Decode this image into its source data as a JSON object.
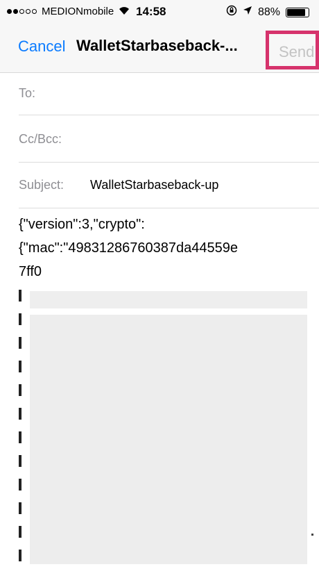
{
  "status_bar": {
    "signal_filled": 2,
    "signal_empty": 3,
    "carrier": "MEDIONmobile",
    "time": "14:58",
    "battery": "88%",
    "icons": [
      "wifi-icon",
      "lock-rotation-icon",
      "location-arrow-icon",
      "battery-icon"
    ]
  },
  "nav": {
    "cancel_label": "Cancel",
    "title": "WalletStarbaseback-...",
    "send_label": "Send",
    "highlight_color": "#d6336c",
    "accent_color": "#0a7bff"
  },
  "fields": {
    "to_label": "To:",
    "cc_label": "Cc/Bcc:",
    "subject_label": "Subject:",
    "subject_value": "WalletStarbaseback-up"
  },
  "body": {
    "lines": [
      "{\"version\":3,\"crypto\":",
      "{\"mac\":\"49831286760387da44559e",
      "7ff0"
    ]
  }
}
